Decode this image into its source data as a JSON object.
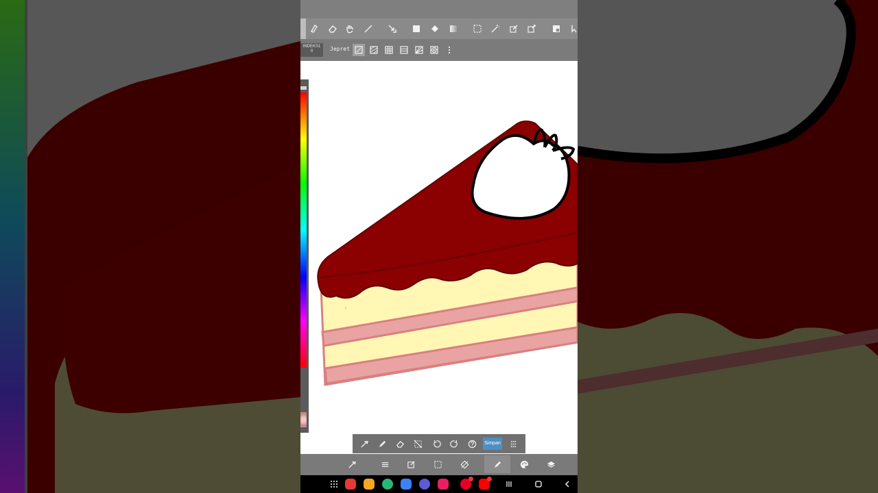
{
  "app": {
    "name": "drawing-app"
  },
  "toolbar_secondary": {
    "index_label": "INDEKS1",
    "index_value": "0",
    "snap_label": "Jepret"
  },
  "floating_toolbar": {
    "save_label": "Simpan"
  },
  "colors": {
    "accent": "#4d8fc4",
    "toolbar_bg": "#8a8a8a",
    "canvas_bg": "#ffffff",
    "glaze": "#8b0000",
    "cream": "#fff7b3",
    "cake_layer": "#e9a3a3"
  },
  "toolbar_icons": [
    "brush-icon",
    "eraser-icon",
    "hand-pan-icon",
    "line-icon",
    "transform-icon",
    "fill-rectangle-icon",
    "bucket-fill-icon",
    "gradient-icon",
    "select-rect-icon",
    "magic-wand-icon",
    "select-pen-icon",
    "select-eraser-icon",
    "layout-icon",
    "select-arrow-icon"
  ],
  "snap_icons": [
    "snap-off-icon",
    "snap-parallel-icon",
    "snap-grid-icon",
    "snap-horizontal-icon",
    "snap-perspective-icon",
    "snap-concentric-icon",
    "more-icon"
  ],
  "float_icons": [
    "eyedropper-icon",
    "pen-icon",
    "eraser-icon",
    "clear-icon",
    "undo-icon",
    "redo-icon",
    "help-icon",
    "grid-handle-icon"
  ],
  "bottom_icons": [
    "eyedropper-icon",
    "menu-icon",
    "edit-icon",
    "select-icon",
    "rotate-icon",
    "pen-icon",
    "palette-icon",
    "layers-icon"
  ],
  "nav_apps": [
    "apps-grid-icon",
    "flipboard-app",
    "files-app",
    "chrome-app",
    "messages-app",
    "samsung-internet-app",
    "camera-app",
    "pinterest-app",
    "youtube-app"
  ],
  "nav_buttons": [
    "recent-apps-icon",
    "home-icon",
    "back-icon"
  ]
}
